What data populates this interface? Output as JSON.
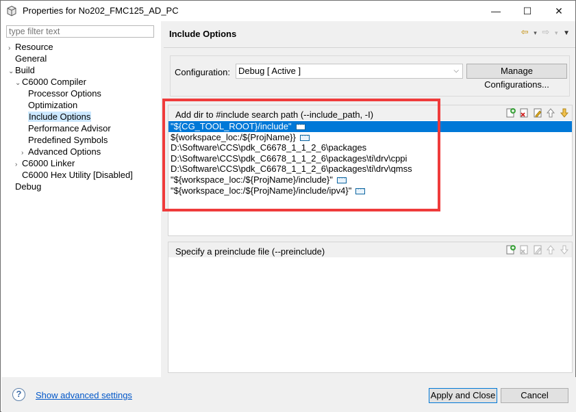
{
  "window": {
    "title": "Properties for No202_FMC125_AD_PC",
    "controls": {
      "minimize": "—",
      "maximize": "☐",
      "close": "✕"
    }
  },
  "left_pane": {
    "filter_placeholder": "type filter text",
    "tree": [
      {
        "label": "Resource",
        "arrow": "›"
      },
      {
        "label": "General",
        "arrow": ""
      },
      {
        "label": "Build",
        "arrow": "⌄"
      },
      {
        "label": "C6000 Compiler",
        "arrow": "⌄"
      },
      {
        "label": "Processor Options",
        "arrow": ""
      },
      {
        "label": "Optimization",
        "arrow": ""
      },
      {
        "label": "Include Options",
        "arrow": "",
        "selected": true
      },
      {
        "label": "Performance Advisor",
        "arrow": ""
      },
      {
        "label": "Predefined Symbols",
        "arrow": ""
      },
      {
        "label": "Advanced Options",
        "arrow": "›"
      },
      {
        "label": "C6000 Linker",
        "arrow": "›"
      },
      {
        "label": "C6000 Hex Utility  [Disabled]",
        "arrow": ""
      },
      {
        "label": "Debug",
        "arrow": ""
      }
    ]
  },
  "right_pane": {
    "page_title": "Include Options",
    "nav_icons": [
      "back-arrow-icon",
      "dropdown-icon",
      "forward-arrow-icon",
      "dropdown-icon",
      "view-menu-icon"
    ],
    "configuration_label": "Configuration:",
    "configuration_value": "Debug  [ Active ]",
    "manage_button": "Manage Configurations...",
    "include_panel": {
      "header": "Add dir to #include search path (--include_path, -I)",
      "rows": [
        {
          "text": "\"${CG_TOOL_ROOT}/include\"",
          "selected": true
        },
        {
          "text": "${workspace_loc:/${ProjName}}",
          "selected": false
        },
        {
          "text": "D:\\Software\\CCS\\pdk_C6678_1_1_2_6\\packages",
          "selected": false,
          "no_dots": true
        },
        {
          "text": "D:\\Software\\CCS\\pdk_C6678_1_1_2_6\\packages\\ti\\drv\\cppi",
          "selected": false,
          "no_dots": true
        },
        {
          "text": "D:\\Software\\CCS\\pdk_C6678_1_1_2_6\\packages\\ti\\drv\\qmss",
          "selected": false,
          "no_dots": true
        },
        {
          "text": "\"${workspace_loc:/${ProjName}/include}\"",
          "selected": false
        },
        {
          "text": "\"${workspace_loc:/${ProjName}/include/ipv4}\"",
          "selected": false
        }
      ]
    },
    "preinclude_panel": {
      "header": "Specify a preinclude file (--preinclude)",
      "rows": []
    }
  },
  "bottom_bar": {
    "help_icon_glyph": "?",
    "advanced_link": "Show advanced settings",
    "apply_button": "Apply and Close",
    "cancel_button": "Cancel"
  },
  "colors": {
    "selection": "#0078d7",
    "highlight_box": "#ef3b3b",
    "link": "#0056c8"
  }
}
